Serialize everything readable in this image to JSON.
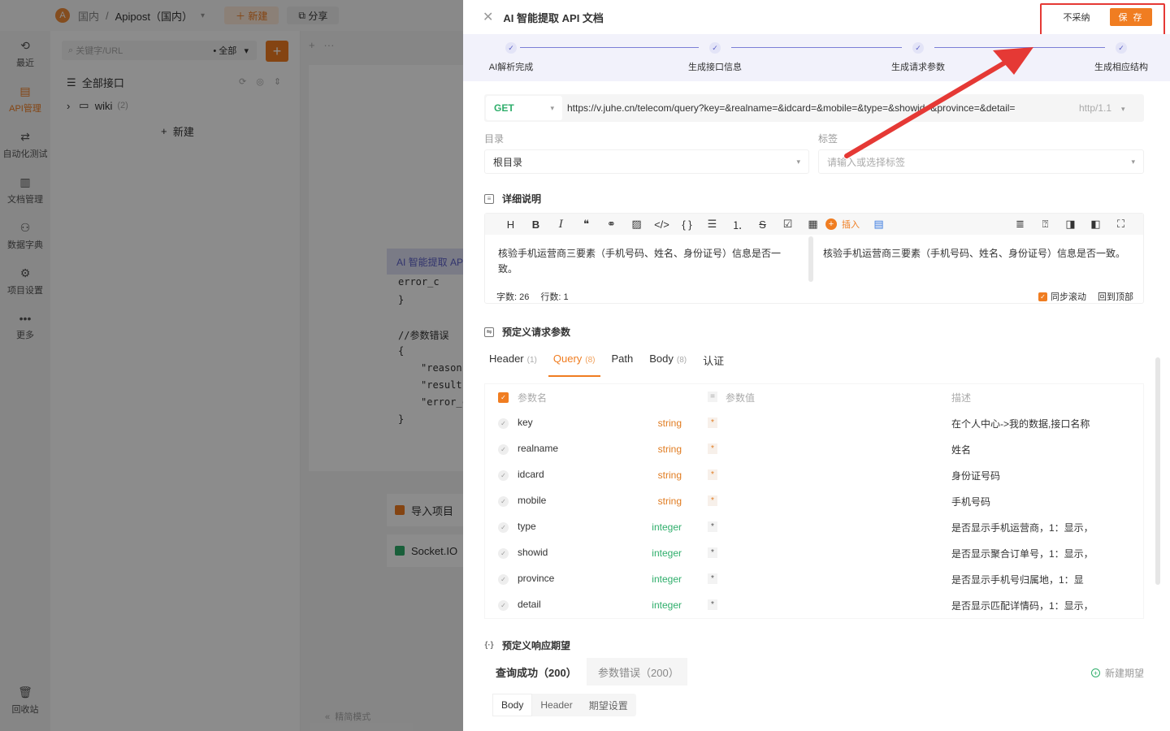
{
  "app": {
    "logo_letter": "A",
    "breadcrumb_team": "国内",
    "breadcrumb_sep": "/",
    "breadcrumb_project": "Apipost（国内）",
    "new_btn": "新建",
    "share_btn": "分享"
  },
  "nav": {
    "recent": "最近",
    "api": "API管理",
    "autotest": "自动化测试",
    "docs": "文档管理",
    "dict": "数据字典",
    "settings": "项目设置",
    "more": "更多",
    "trash": "回收站"
  },
  "tree": {
    "search_placeholder": "关键字/URL",
    "filter_all": "全部",
    "all_apis": "全部接口",
    "folder": "wiki",
    "folder_count": "(2)",
    "new": "新建"
  },
  "mid": {
    "code_lines": [
      "}",
      "//参数错误",
      "{",
      "\"reason\":",
      "\"result\":n",
      "\"error_co",
      "}"
    ],
    "code_frag": "error_c",
    "ai_pill": "AI 智能提取 API",
    "import_card": "导入项目",
    "socket_card": "Socket.IO",
    "precise_mode": "精简模式"
  },
  "drawer": {
    "title": "AI 智能提取 API 文档",
    "reject_btn": "不采纳",
    "save_btn": "保 存",
    "steps": [
      "AI解析完成",
      "生成接口信息",
      "生成请求参数",
      "生成相应结构"
    ],
    "method": "GET",
    "url": "https://v.juhe.cn/telecom/query?key=&realname=&idcard=&mobile=&type=&showid=&province=&detail=",
    "http_version": "http/1.1",
    "dir_label": "目录",
    "dir_value": "根目录",
    "tag_label": "标签",
    "tag_placeholder": "请输入或选择标签",
    "detail_title": "详细说明",
    "insert_label": "插入",
    "editor_text_left": "核验手机运营商三要素（手机号码、姓名、身份证号）信息是否一致。",
    "editor_text_right": "核验手机运营商三要素（手机号码、姓名、身份证号）信息是否一致。",
    "char_count": "字数: 26",
    "line_count": "行数: 1",
    "sync_scroll": "同步滚动",
    "back_top": "回到顶部",
    "req_title": "预定义请求参数",
    "req_tabs": [
      {
        "label": "Header",
        "count": "(1)"
      },
      {
        "label": "Query",
        "count": "(8)"
      },
      {
        "label": "Path",
        "count": ""
      },
      {
        "label": "Body",
        "count": "(8)"
      },
      {
        "label": "认证",
        "count": ""
      }
    ],
    "col_name": "参数名",
    "col_value": "参数值",
    "col_desc": "描述",
    "params": [
      {
        "name": "key",
        "type": "string",
        "req": "*",
        "desc": "在个人中心->我的数据,接口名称"
      },
      {
        "name": "realname",
        "type": "string",
        "req": "*",
        "desc": "姓名"
      },
      {
        "name": "idcard",
        "type": "string",
        "req": "*",
        "desc": "身份证号码"
      },
      {
        "name": "mobile",
        "type": "string",
        "req": "*",
        "desc": "手机号码"
      },
      {
        "name": "type",
        "type": "integer",
        "req": "*",
        "desc": "是否显示手机运营商，1：显示，"
      },
      {
        "name": "showid",
        "type": "integer",
        "req": "*",
        "desc": "是否显示聚合订单号，1：显示，"
      },
      {
        "name": "province",
        "type": "integer",
        "req": "*",
        "desc": "是否显示手机号归属地，1：显"
      },
      {
        "name": "detail",
        "type": "integer",
        "req": "*",
        "desc": "是否显示匹配详情码，1：显示，"
      }
    ],
    "resp_title": "预定义响应期望",
    "resp_tab_active": "查询成功（200）",
    "resp_tab_other": "参数错误（200）",
    "new_expect": "新建期望",
    "body_tabs": [
      "Body",
      "Header",
      "期望设置"
    ]
  }
}
